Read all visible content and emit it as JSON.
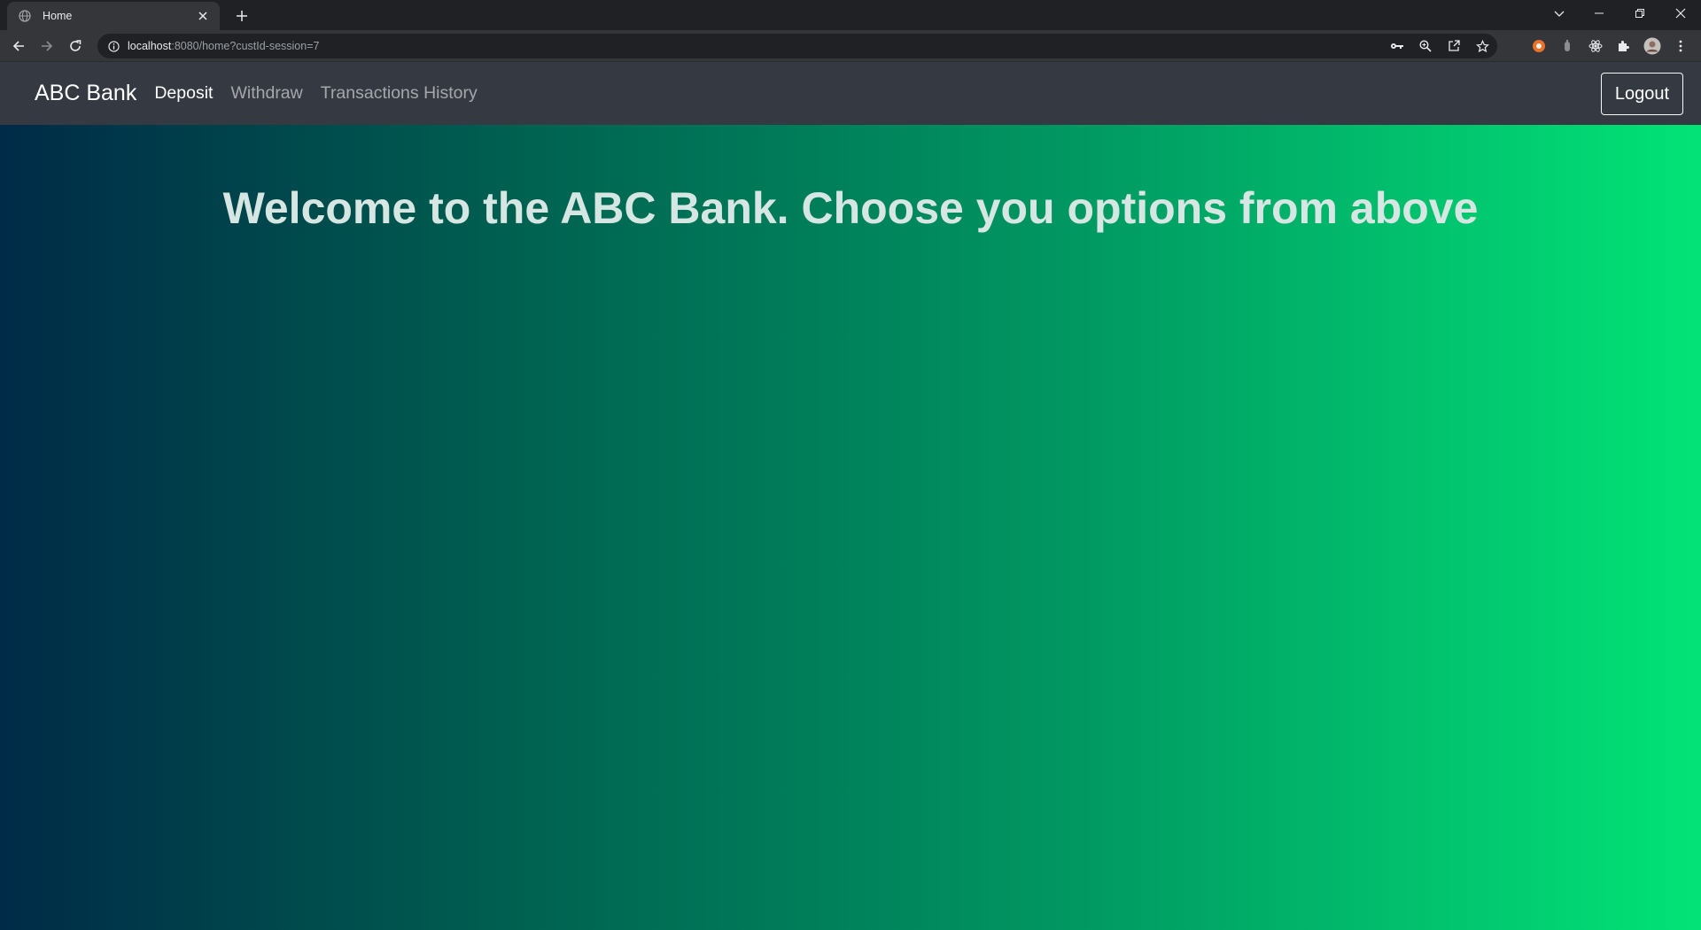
{
  "browser": {
    "tab": {
      "title": "Home"
    },
    "address": {
      "host": "localhost",
      "path": ":8080/home?custId-session=7"
    }
  },
  "navbar": {
    "brand": "ABC Bank",
    "links": [
      {
        "label": "Deposit",
        "active": true
      },
      {
        "label": "Withdraw",
        "active": false
      },
      {
        "label": "Transactions History",
        "active": false
      }
    ],
    "logout_label": "Logout"
  },
  "main": {
    "heading": "Welcome to the ABC Bank. Choose you options from above"
  },
  "colors": {
    "navbar_bg": "#353a42",
    "gradient_start": "#002a47",
    "gradient_end": "#02e377",
    "heading_text": "#d5e6e3"
  },
  "icons": [
    "globe-icon",
    "close-icon",
    "plus-icon",
    "chevron-down-icon",
    "minimize-icon",
    "restore-icon",
    "window-close-icon",
    "back-arrow-icon",
    "forward-arrow-icon",
    "reload-icon",
    "info-icon",
    "key-icon",
    "zoom-icon",
    "share-icon",
    "star-icon",
    "brave-ext-icon",
    "ext-icon",
    "react-devtools-icon",
    "puzzle-icon",
    "profile-avatar-icon",
    "more-vert-icon"
  ]
}
